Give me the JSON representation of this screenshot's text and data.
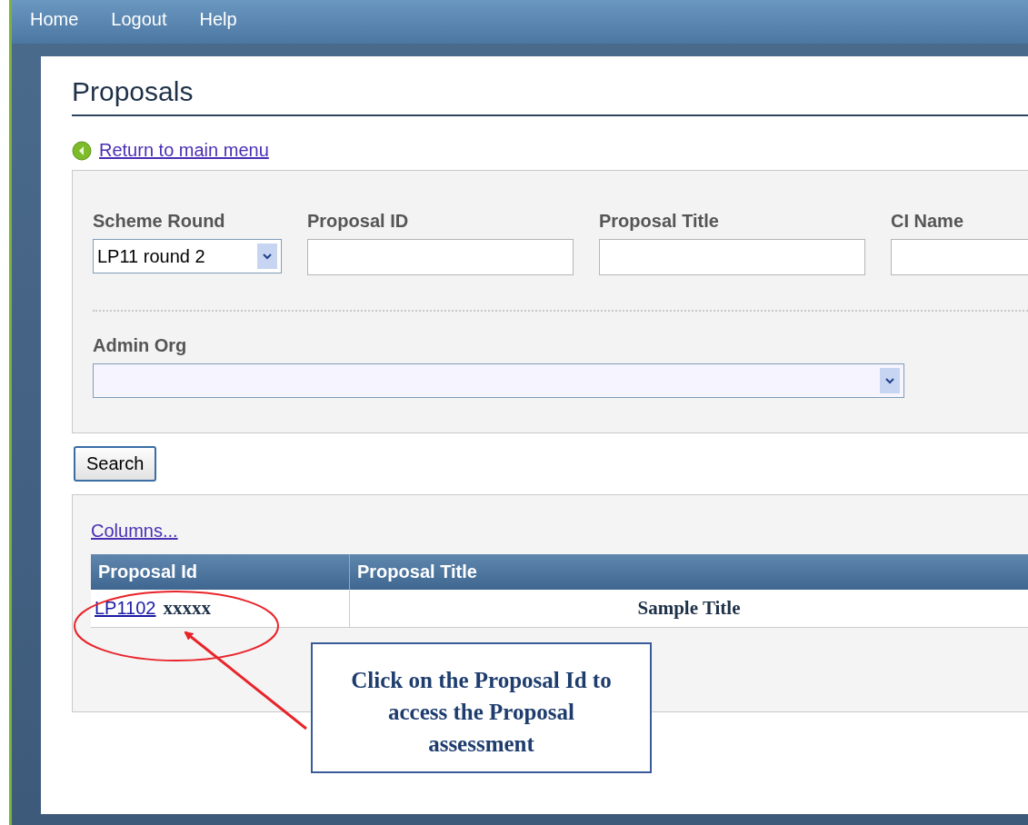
{
  "menu": [
    {
      "label": "Home"
    },
    {
      "label": "Logout"
    },
    {
      "label": "Help"
    }
  ],
  "page_title": "Proposals",
  "return_link": "Return to main menu",
  "filters": [
    {
      "kind": "select",
      "label": "Scheme Round",
      "value": "LP11 round 2"
    },
    {
      "kind": "input",
      "label": "Proposal ID"
    },
    {
      "kind": "input",
      "label": "Proposal Title"
    },
    {
      "kind": "input",
      "label": "CI Name"
    }
  ],
  "admin_org": {
    "label": "Admin Org"
  },
  "search_button": "Search",
  "results": {
    "columns_link": "Columns...",
    "columns": [
      "Proposal Id",
      "Proposal Title"
    ],
    "rows": [
      {
        "proposal_id": "LP1102",
        "suffix": "xxxxx",
        "title": "Sample Title"
      }
    ]
  },
  "callout": "Click on the Proposal Id to access the Proposal assessment"
}
